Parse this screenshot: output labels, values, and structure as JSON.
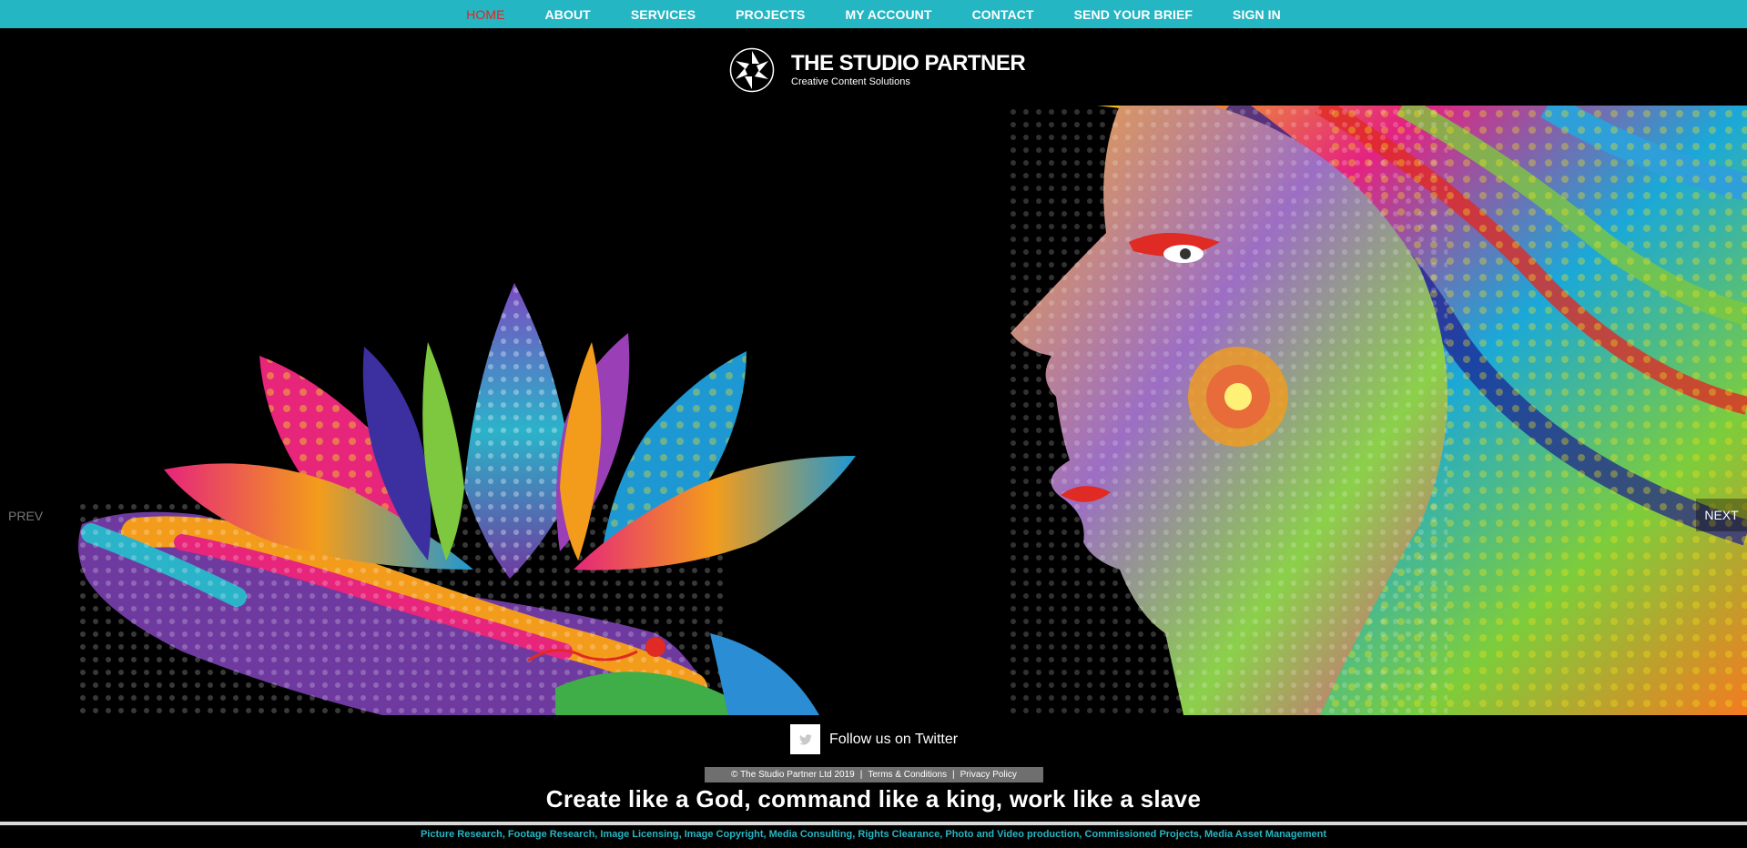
{
  "nav": {
    "items": [
      {
        "label": "HOME",
        "active": true
      },
      {
        "label": "ABOUT"
      },
      {
        "label": "SERVICES"
      },
      {
        "label": "PROJECTS"
      },
      {
        "label": "MY ACCOUNT"
      },
      {
        "label": "CONTACT"
      },
      {
        "label": "SEND YOUR BRIEF"
      },
      {
        "label": "SIGN IN"
      }
    ],
    "bg_color": "#25b6c3",
    "active_color": "#e3251b"
  },
  "brand": {
    "title": "THE STUDIO PARTNER",
    "subtitle": "Creative Content Solutions",
    "icon": "aperture-icon"
  },
  "slider": {
    "prev_label": "PREV",
    "next_label": "NEXT"
  },
  "social": {
    "icon": "twitter-icon",
    "label": "Follow us on Twitter"
  },
  "footer": {
    "copyright": "© The Studio Partner Ltd 2019",
    "separator": "|",
    "terms": "Terms & Conditions",
    "privacy": "Privacy Policy",
    "slogan": "Create like a God, command like a king, work like a slave",
    "services": "Picture Research, Footage Research, Image Licensing, Image Copyright, Media Consulting, Rights Clearance, Photo and Video production, Commissioned Projects, Media Asset Management"
  }
}
